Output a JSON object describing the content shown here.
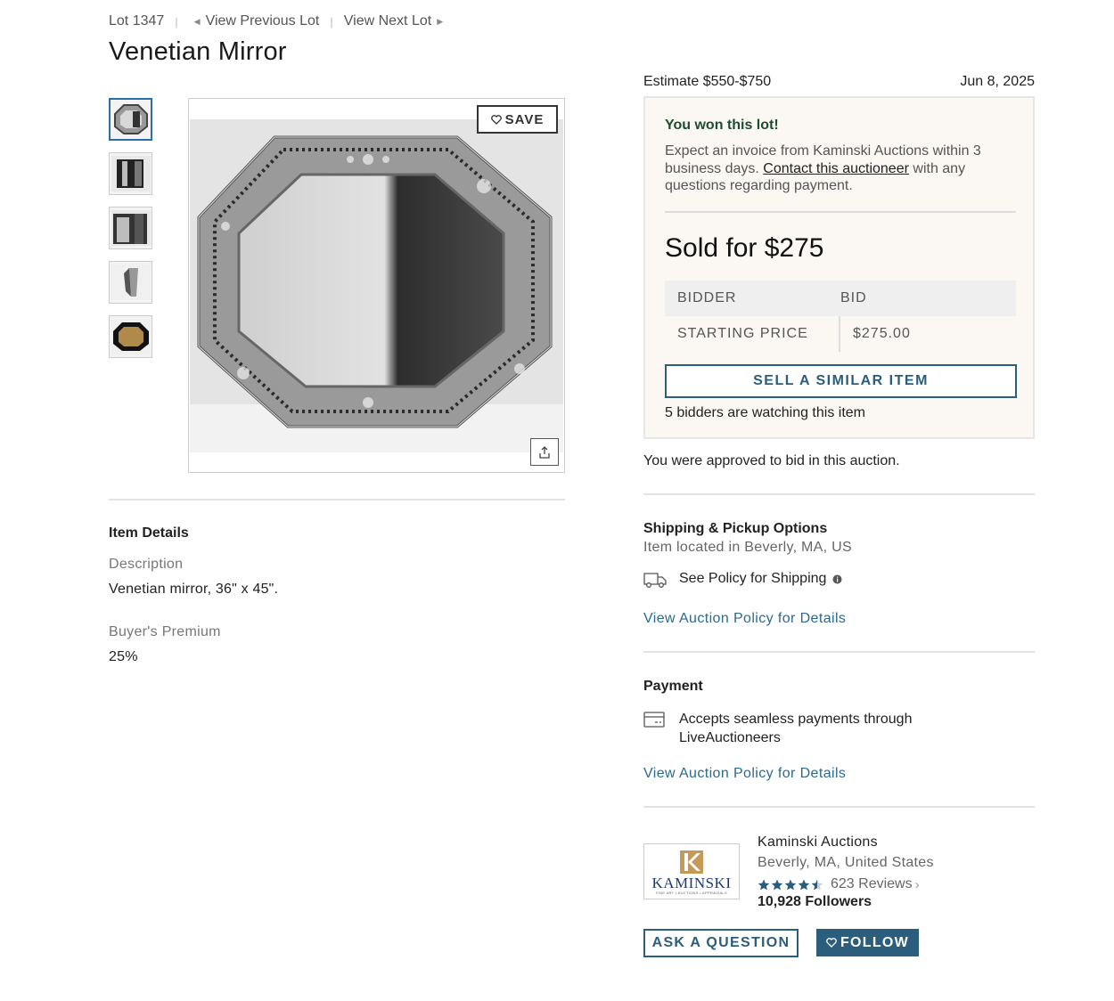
{
  "lotnav": {
    "lot": "Lot 1347",
    "prev": "View Previous Lot",
    "next": "View Next Lot"
  },
  "title": "Venetian Mirror",
  "gallery": {
    "save_label": "SAVE",
    "thumbnails": [
      "mirror-front",
      "mirror-side-1",
      "mirror-side-2",
      "mirror-edge",
      "mirror-back"
    ]
  },
  "details": {
    "heading": "Item Details",
    "description_label": "Description",
    "description": "Venetian mirror, 36\" x 45\".",
    "premium_label": "Buyer's Premium",
    "premium": "25%"
  },
  "summary": {
    "estimate": "Estimate $550-$750",
    "date": "Jun 8, 2025",
    "won_heading": "You won this lot!",
    "won_text_1": "Expect an invoice from Kaminski Auctions within 3 business days. ",
    "won_link": "Contact this auctioneer",
    "won_text_2": " with any questions regarding payment.",
    "sold": "Sold for $275",
    "bid_headers": [
      "BIDDER",
      "BID"
    ],
    "bid_rows": [
      {
        "bidder": "STARTING PRICE",
        "bid": "$275.00"
      }
    ],
    "sell_button": "SELL A SIMILAR ITEM",
    "watching": "5 bidders are watching this item",
    "approved": "You were approved to bid in this auction."
  },
  "shipping": {
    "heading": "Shipping & Pickup Options",
    "location": "Item located in Beverly, MA, US",
    "policy": "See Policy for Shipping",
    "link": "View Auction Policy for Details"
  },
  "payment": {
    "heading": "Payment",
    "text": "Accepts seamless payments through LiveAuctioneers",
    "link": "View Auction Policy for Details"
  },
  "house": {
    "logo_word": "KAMINSKI",
    "logo_tagline": "FINE ART • AUCTIONS • APPRAISALS",
    "name": "Kaminski Auctions",
    "location": "Beverly, MA, United States",
    "rating": 4.5,
    "reviews": "623 Reviews",
    "followers": "10,928 Followers",
    "ask_button": "ASK A QUESTION",
    "follow_button": "FOLLOW"
  },
  "colors": {
    "accent": "#2b5d7d",
    "link": "#2b6a8f",
    "won_green": "#1e4d2e",
    "won_bg": "#fbf8f4"
  }
}
